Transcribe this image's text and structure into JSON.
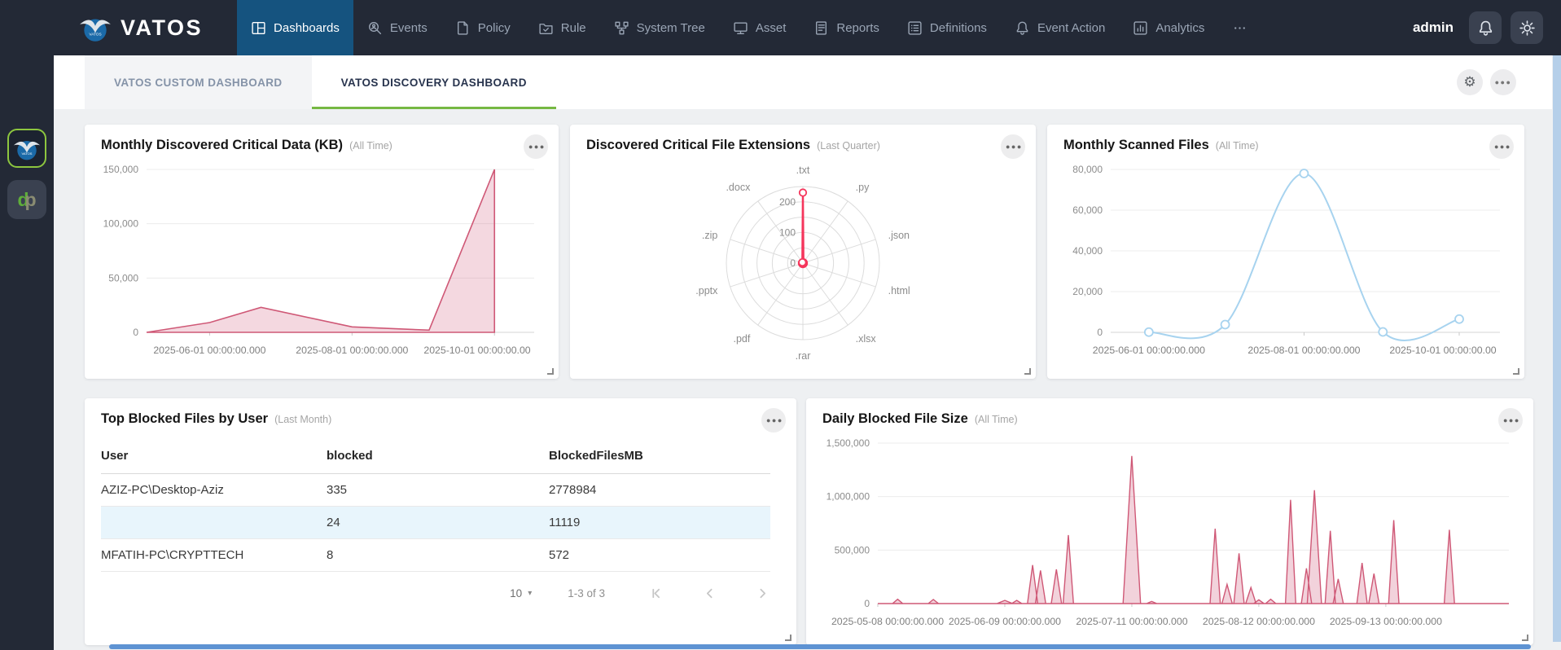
{
  "navbar": {
    "brand": "VATOS",
    "username": "admin",
    "items": [
      {
        "id": "dashboards",
        "label": "Dashboards",
        "icon": "dashboard",
        "active": true
      },
      {
        "id": "events",
        "label": "Events",
        "icon": "search",
        "active": false
      },
      {
        "id": "policy",
        "label": "Policy",
        "icon": "document",
        "active": false
      },
      {
        "id": "rule",
        "label": "Rule",
        "icon": "folder-check",
        "active": false
      },
      {
        "id": "system-tree",
        "label": "System Tree",
        "icon": "tree",
        "active": false
      },
      {
        "id": "asset",
        "label": "Asset",
        "icon": "monitor",
        "active": false
      },
      {
        "id": "reports",
        "label": "Reports",
        "icon": "report",
        "active": false
      },
      {
        "id": "definitions",
        "label": "Definitions",
        "icon": "list",
        "active": false
      },
      {
        "id": "event-action",
        "label": "Event Action",
        "icon": "bell",
        "active": false
      },
      {
        "id": "analytics",
        "label": "Analytics",
        "icon": "analytics",
        "active": false
      },
      {
        "id": "more",
        "label": "",
        "icon": "more",
        "active": false
      }
    ]
  },
  "app_switcher": {
    "apps": [
      {
        "id": "vatos",
        "active": true
      },
      {
        "id": "dp",
        "active": false,
        "letters": [
          "d",
          "p"
        ]
      }
    ]
  },
  "tabs": [
    {
      "label": "VATOS CUSTOM DASHBOARD",
      "active": false
    },
    {
      "label": "VATOS DISCOVERY DASHBOARD",
      "active": true
    }
  ],
  "cards": [
    {
      "title": "Monthly Discovered Critical Data (KB)",
      "period": "(All Time)"
    },
    {
      "title": "Discovered Critical File Extensions",
      "period": "(Last Quarter)"
    },
    {
      "title": "Monthly Scanned Files",
      "period": "(All Time)"
    },
    {
      "title": "Top Blocked Files by User",
      "period": "(Last Month)"
    },
    {
      "title": "Daily Blocked File Size",
      "period": "(All Time)"
    }
  ],
  "colors": {
    "navbar_bg": "#232936",
    "active_nav_bg": "#15537f",
    "tab_underline": "#76b843",
    "pink_series": "#cf5876",
    "red_radar": "#f5365c",
    "blue_line": "#a7d3ef",
    "row_highlight": "#e8f5fc",
    "vertical_scrollbar": "#b5cfe9",
    "horizontal_scrollbar": "#5e93d3",
    "rail_icon_border": "#8dc63f"
  },
  "chart_data": [
    {
      "id": "monthly-discovered-critical-data",
      "type": "area",
      "title": "Monthly Discovered Critical Data (KB)",
      "period": "(All Time)",
      "x": [
        "2025-05-05",
        "2025-06-01",
        "2025-06-23",
        "2025-08-01",
        "2025-09-03",
        "2025-10-01"
      ],
      "values": [
        0,
        9000,
        23000,
        5000,
        2000,
        150000
      ],
      "x_domain": [
        "2025-05-05",
        "2025-10-18"
      ],
      "ylim": [
        0,
        150000
      ],
      "y_ticks": [
        0,
        50000,
        100000,
        150000
      ],
      "x_tick_dates": [
        "2025-06-01",
        "2025-08-01",
        "2025-10-01"
      ],
      "x_tick_labels": [
        "2025-06-01 00:00:00.000",
        "2025-08-01 00:00:00.000",
        "2025-10-01 00:00:00.00"
      ],
      "grid": true,
      "legend": false,
      "curve": "linear",
      "color": "#cf5876",
      "fill": "rgba(208,92,124,0.24)"
    },
    {
      "id": "discovered-critical-file-extensions",
      "type": "radar",
      "title": "Discovered Critical File Extensions",
      "period": "(Last Quarter)",
      "categories": [
        ".txt",
        ".py",
        ".json",
        ".html",
        ".xlsx",
        ".rar",
        ".pdf",
        ".pptx",
        ".zip",
        ".docx"
      ],
      "values": [
        230,
        3,
        3,
        3,
        3,
        3,
        3,
        3,
        3,
        3
      ],
      "rmax": 250,
      "rings": 5,
      "ring_tick_values": [
        0,
        100,
        200
      ],
      "ring_tick_labels": [
        "0",
        "100",
        "200"
      ],
      "color": "#f5365c"
    },
    {
      "id": "monthly-scanned-files",
      "type": "line",
      "title": "Monthly Scanned Files",
      "period": "(All Time)",
      "x": [
        "2025-06-01",
        "2025-07-01",
        "2025-08-01",
        "2025-09-01",
        "2025-10-01"
      ],
      "values": [
        100,
        3800,
        78000,
        200,
        6500
      ],
      "x_domain": [
        "2025-05-17",
        "2025-10-17"
      ],
      "ylim": [
        0,
        80000
      ],
      "y_ticks": [
        0,
        20000,
        40000,
        60000,
        80000
      ],
      "x_tick_dates": [
        "2025-06-01",
        "2025-08-01",
        "2025-10-01"
      ],
      "x_tick_labels": [
        "2025-06-01 00:00:00.000",
        "2025-08-01 00:00:00.000",
        "2025-10-01 00:00:00.00"
      ],
      "grid": true,
      "legend": false,
      "curve": "smooth",
      "markers": true,
      "color": "#a7d3ef"
    },
    {
      "id": "top-blocked-files-by-user",
      "type": "table",
      "title": "Top Blocked Files by User",
      "period": "(Last Month)",
      "columns": [
        "User",
        "blocked",
        "BlockedFilesMB"
      ],
      "rows": [
        [
          "AZIZ-PC\\Desktop-Aziz",
          "335",
          "2778984"
        ],
        [
          "",
          "24",
          "11119"
        ],
        [
          "MFATIH-PC\\CRYPTTECH",
          "8",
          "572"
        ]
      ],
      "highlighted_row_index": 1,
      "page_size": "10",
      "range_label": "1-3 of 3"
    },
    {
      "id": "daily-blocked-file-size",
      "type": "spike-area",
      "title": "Daily Blocked File Size",
      "period": "(All Time)",
      "x_domain": [
        "2025-05-08",
        "2025-10-14"
      ],
      "spikes": [
        [
          "2025-05-13",
          40000
        ],
        [
          "2025-05-22",
          38000
        ],
        [
          "2025-06-09",
          30000,
          2
        ],
        [
          "2025-06-12",
          30000
        ],
        [
          "2025-06-16",
          360000
        ],
        [
          "2025-06-18",
          310000
        ],
        [
          "2025-06-22",
          320000
        ],
        [
          "2025-06-25",
          640000
        ],
        [
          "2025-07-11",
          1380000,
          2.2
        ],
        [
          "2025-07-16",
          20000
        ],
        [
          "2025-08-01",
          700000
        ],
        [
          "2025-08-04",
          180000
        ],
        [
          "2025-08-07",
          470000
        ],
        [
          "2025-08-10",
          150000
        ],
        [
          "2025-08-12",
          35000
        ],
        [
          "2025-08-15",
          40000
        ],
        [
          "2025-08-20",
          970000
        ],
        [
          "2025-08-24",
          330000
        ],
        [
          "2025-08-26",
          1060000,
          1.8
        ],
        [
          "2025-08-30",
          680000
        ],
        [
          "2025-09-01",
          230000
        ],
        [
          "2025-09-07",
          380000
        ],
        [
          "2025-09-10",
          280000
        ],
        [
          "2025-09-15",
          780000
        ],
        [
          "2025-09-29",
          690000
        ]
      ],
      "ylim": [
        0,
        1500000
      ],
      "y_ticks": [
        0,
        500000,
        1000000,
        1500000
      ],
      "x_tick_dates": [
        "2025-05-08",
        "2025-06-09",
        "2025-07-11",
        "2025-08-12",
        "2025-09-13"
      ],
      "x_tick_labels": [
        "2025-05-08 00:00:00.000",
        "2025-06-09 00:00:00.000",
        "2025-07-11 00:00:00.000",
        "2025-08-12 00:00:00.000",
        "2025-09-13 00:00:00.000"
      ],
      "grid": true,
      "legend": false,
      "color": "#cf5876",
      "fill": "rgba(208,92,124,0.28)"
    }
  ]
}
